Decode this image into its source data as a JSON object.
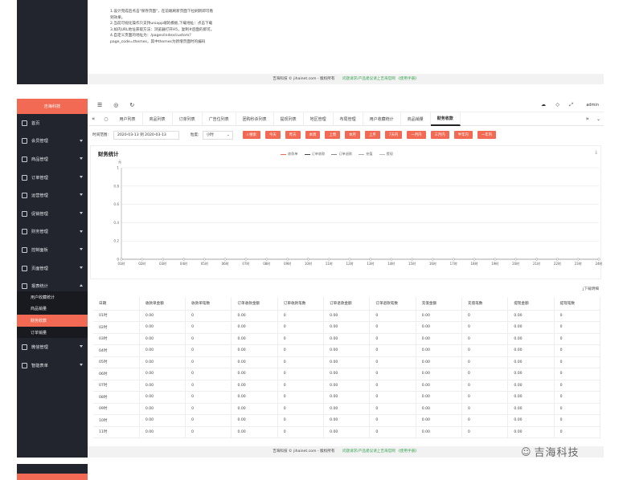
{
  "top_notes": [
    "1.设计完成后点击\"保存页面\"，在前端刷新页面下拉刷新即可看到效果。",
    "2.当前可视化操作只支持uniapp端的模板,下载地址：点击下载",
    "3.如内URL地址获取方法：浏览器打开H5，复制#后面的即可。",
    "4.自定义页面的地址为：/pages/index/custom?page_code=themes，其中themes为新增页面时的编码"
  ],
  "footer": {
    "copyright": "吉海科技 © jihainet.com - 版权所有",
    "links": "问题请求/产品建议请上吉海官网 《使用手册》"
  },
  "brand": "吉海科技",
  "header": {
    "user": "admin"
  },
  "sidebar": {
    "items": [
      {
        "label": "首页",
        "icon": "home-icon",
        "arrow": false
      },
      {
        "label": "会员管理",
        "icon": "user-icon",
        "arrow": true
      },
      {
        "label": "商品管理",
        "icon": "goods-icon",
        "arrow": true
      },
      {
        "label": "订单管理",
        "icon": "order-icon",
        "arrow": true
      },
      {
        "label": "运营管理",
        "icon": "operation-icon",
        "arrow": true
      },
      {
        "label": "促销管理",
        "icon": "promotion-icon",
        "arrow": true
      },
      {
        "label": "财务管理",
        "icon": "finance-icon",
        "arrow": true
      },
      {
        "label": "控制面板",
        "icon": "dashboard-icon",
        "arrow": true
      },
      {
        "label": "页面管理",
        "icon": "page-icon",
        "arrow": true
      },
      {
        "label": "报表统计",
        "icon": "report-icon",
        "arrow": true
      }
    ],
    "sub_items": [
      "用户收藏统计",
      "商品销量",
      "财务收款",
      "订单销量"
    ],
    "active_sub": "财务收款",
    "items_after": [
      {
        "label": "微信管理",
        "icon": "wechat-icon"
      },
      {
        "label": "智能表单",
        "icon": "form-icon"
      }
    ]
  },
  "tabs": [
    "用户列表",
    "商品列表",
    "订单列表",
    "广告位列表",
    "团购秒杀列表",
    "提现列表",
    "地区管理",
    "布局管理",
    "用户收藏统计",
    "商品销量",
    "财务收款"
  ],
  "active_tab": "财务收款",
  "filter": {
    "range_label": "时间范围:",
    "range_value": "2020-03-13 到 2020-03-13",
    "granularity_label": "粒度:",
    "granularity_value": "小时",
    "search": "搜索",
    "buttons": [
      "今天",
      "昨天",
      "本周",
      "上周",
      "本月",
      "上月",
      "7天内",
      "一月内",
      "三月内",
      "半年内",
      "一年内"
    ]
  },
  "chart_data": {
    "type": "line",
    "title": "财务统计",
    "y_unit": "元",
    "series": [
      {
        "name": "收款单",
        "color": "#f26a53"
      },
      {
        "name": "订单收款",
        "color": "#444"
      },
      {
        "name": "订单退款",
        "color": "#888"
      },
      {
        "name": "充值",
        "color": "#aaa"
      },
      {
        "name": "提现",
        "color": "#bbb"
      }
    ],
    "categories": [
      "01时",
      "02时",
      "03时",
      "04时",
      "05时",
      "06时",
      "07时",
      "08时",
      "09时",
      "10时",
      "11时",
      "12时",
      "13时",
      "14时",
      "15时",
      "16时",
      "17时",
      "18时",
      "19时",
      "20时",
      "21时",
      "22时",
      "23时",
      "24时"
    ],
    "yticks": [
      "1",
      "0.8",
      "0.6",
      "0.4",
      "0.2",
      "0"
    ],
    "values": [
      0,
      0,
      0,
      0,
      0,
      0,
      0,
      0,
      0,
      0,
      0,
      0,
      0,
      0,
      0,
      0,
      0,
      0,
      0,
      0,
      0,
      0,
      0,
      0
    ],
    "ylim": [
      0,
      1
    ]
  },
  "download_label": "下载明细",
  "table": {
    "headers": [
      "日期",
      "收款单金额",
      "收款单笔数",
      "订单收款金额",
      "订单收款笔数",
      "订单退款金额",
      "订单退款笔数",
      "充值金额",
      "充值笔数",
      "提现金额",
      "提现笔数"
    ],
    "rows": [
      [
        "01时",
        "0.00",
        "0",
        "0.00",
        "0",
        "0.00",
        "0",
        "0.00",
        "0",
        "0.00",
        "0"
      ],
      [
        "02时",
        "0.00",
        "0",
        "0.00",
        "0",
        "0.00",
        "0",
        "0.00",
        "0",
        "0.00",
        "0"
      ],
      [
        "03时",
        "0.00",
        "0",
        "0.00",
        "0",
        "0.00",
        "0",
        "0.00",
        "0",
        "0.00",
        "0"
      ],
      [
        "04时",
        "0.00",
        "0",
        "0.00",
        "0",
        "0.00",
        "0",
        "0.00",
        "0",
        "0.00",
        "0"
      ],
      [
        "05时",
        "0.00",
        "0",
        "0.00",
        "0",
        "0.00",
        "0",
        "0.00",
        "0",
        "0.00",
        "0"
      ],
      [
        "06时",
        "0.00",
        "0",
        "0.00",
        "0",
        "0.00",
        "0",
        "0.00",
        "0",
        "0.00",
        "0"
      ],
      [
        "07时",
        "0.00",
        "0",
        "0.00",
        "0",
        "0.00",
        "0",
        "0.00",
        "0",
        "0.00",
        "0"
      ],
      [
        "08时",
        "0.00",
        "0",
        "0.00",
        "0",
        "0.00",
        "0",
        "0.00",
        "0",
        "0.00",
        "0"
      ],
      [
        "09时",
        "0.00",
        "0",
        "0.00",
        "0",
        "0.00",
        "0",
        "0.00",
        "0",
        "0.00",
        "0"
      ],
      [
        "10时",
        "0.00",
        "0",
        "0.00",
        "0",
        "0.00",
        "0",
        "0.00",
        "0",
        "0.00",
        "0"
      ],
      [
        "11时",
        "0.00",
        "0",
        "0.00",
        "0",
        "0.00",
        "0",
        "0.00",
        "0",
        "0.00",
        "0"
      ]
    ]
  },
  "watermark": "吉海科技"
}
